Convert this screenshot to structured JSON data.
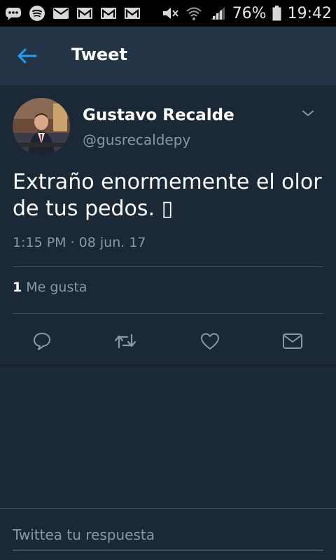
{
  "status_bar": {
    "battery_percent": "76%",
    "time": "19:42",
    "left_icons": [
      "messenger-icon",
      "spotify-icon",
      "mail-icon",
      "gmail-icon",
      "gmail-icon",
      "gmail-icon"
    ],
    "right_icons": [
      "mute-icon",
      "wifi-icon",
      "signal-icon",
      "battery-icon"
    ]
  },
  "app_bar": {
    "title": "Tweet"
  },
  "tweet": {
    "author_name": "Gustavo Recalde",
    "author_handle": "@gusrecaldepy",
    "text": "Extraño enormemente el olor de tus pedos. ▯",
    "timestamp": "1:15 PM · 08 jun. 17",
    "likes_count": "1",
    "likes_label": "Me gusta"
  },
  "reply": {
    "placeholder": "Twittea tu respuesta"
  },
  "colors": {
    "background": "#1b2836",
    "app_bar": "#243447",
    "accent": "#1da1f2",
    "secondary_text": "#8899a6",
    "divider": "#3d4f60"
  }
}
